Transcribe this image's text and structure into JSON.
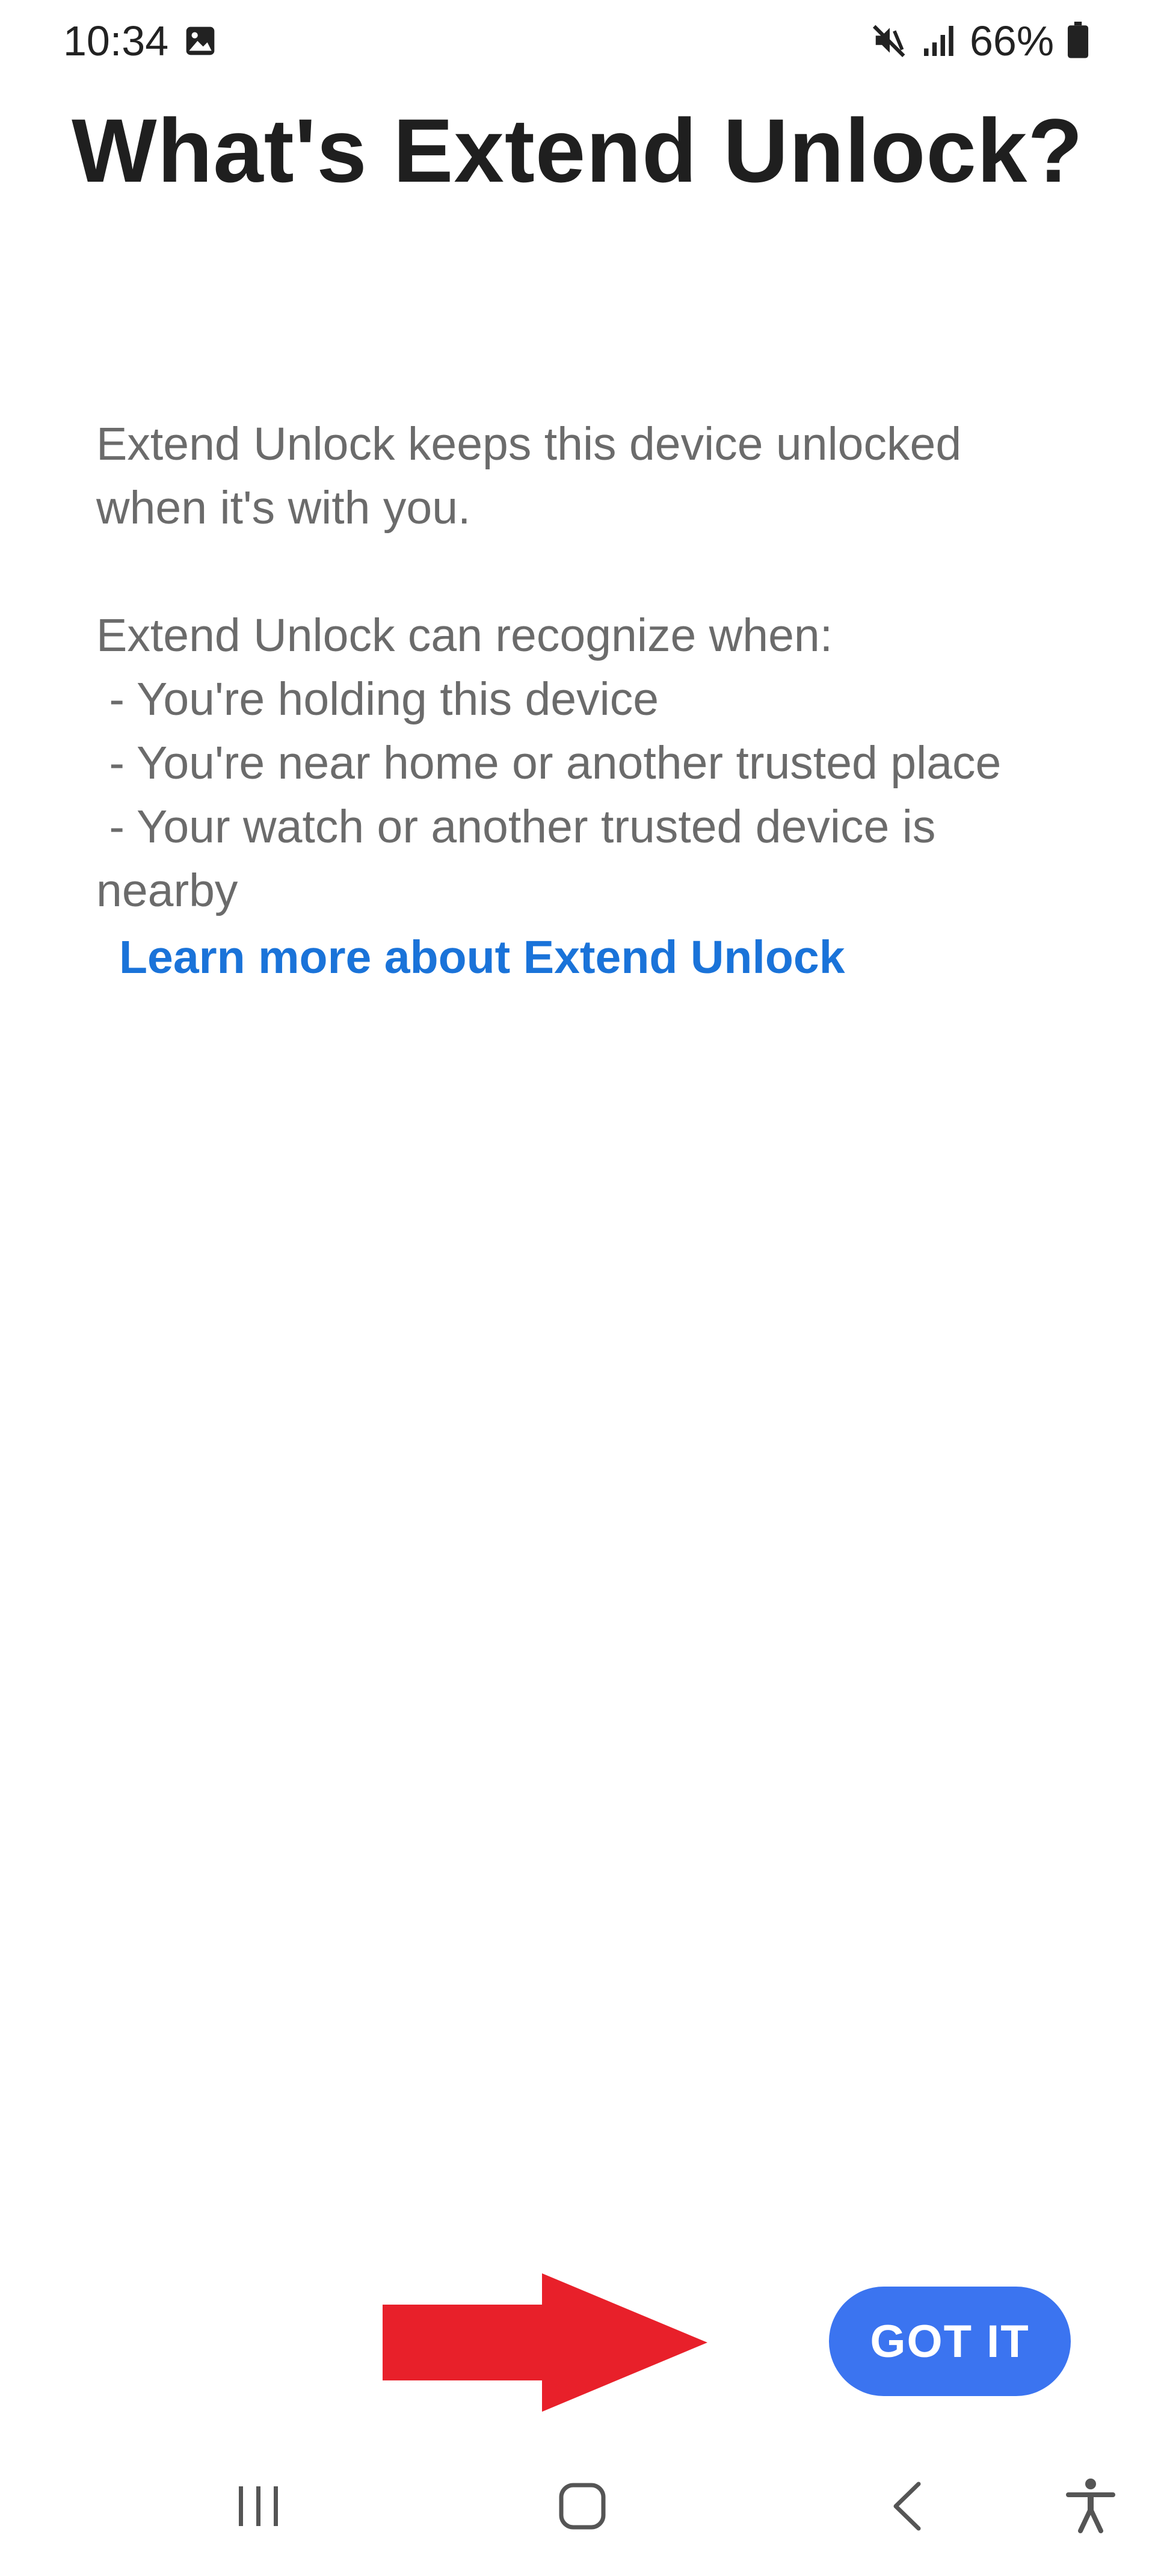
{
  "status_bar": {
    "time": "10:34",
    "battery_percent": "66%",
    "icons": [
      "image-notification-icon",
      "mute-icon",
      "signal-icon",
      "battery-icon"
    ]
  },
  "title": "What's Extend Unlock?",
  "body": {
    "paragraph1_line1": "Extend Unlock keeps this device unlocked",
    "paragraph1_line2": "when it's with you.",
    "paragraph2_intro": "Extend Unlock can recognize when:",
    "bullet1": " - You're holding this device",
    "bullet2": " - You're near home or another trusted place",
    "bullet3_line1": " - Your watch or another trusted device is",
    "bullet3_line2": "nearby"
  },
  "learn_more_link": "Learn more about Extend Unlock",
  "got_it_button": "GOT IT",
  "colors": {
    "accent": "#3b74f0",
    "link": "#1a73d9",
    "arrow": "#e8202a",
    "body_text": "#6b6b6b"
  },
  "nav_bar": {
    "icons": [
      "recent-apps-icon",
      "home-icon",
      "back-icon",
      "accessibility-icon"
    ]
  }
}
